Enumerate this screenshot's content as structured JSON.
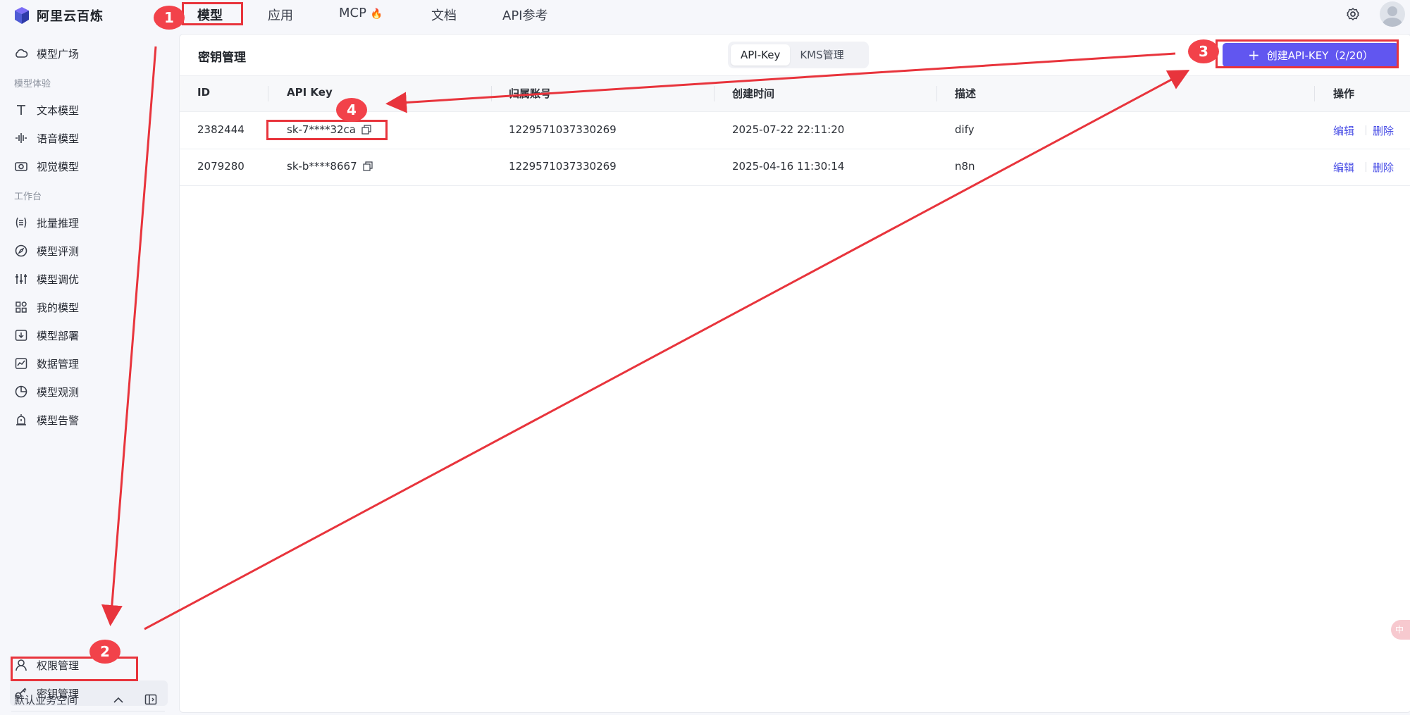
{
  "app": {
    "name": "阿里云百炼"
  },
  "topnav": {
    "items": [
      {
        "label": "模型"
      },
      {
        "label": "应用"
      },
      {
        "label": "MCP"
      },
      {
        "label": "文档"
      },
      {
        "label": "API参考"
      }
    ],
    "mcp_emoji": "🔥"
  },
  "sidebar": {
    "top_item": "模型广场",
    "group1": "模型体验",
    "group1_items": [
      "文本模型",
      "语音模型",
      "视觉模型"
    ],
    "group2": "工作台",
    "group2_items": [
      "批量推理",
      "模型评测",
      "模型调优",
      "我的模型",
      "模型部署",
      "数据管理",
      "模型观测",
      "模型告警"
    ],
    "bottom_items": [
      "权限管理",
      "密钥管理"
    ],
    "workspace": "默认业务空间"
  },
  "main": {
    "title": "密钥管理",
    "tabs": [
      "API-Key",
      "KMS管理"
    ],
    "create_button": "创建API-KEY（2/20）",
    "columns": [
      "ID",
      "API Key",
      "归属账号",
      "创建时间",
      "描述",
      "操作"
    ],
    "rows": [
      {
        "id": "2382444",
        "key": "sk-7****32ca",
        "account": "1229571037330269",
        "created": "2025-07-22 22:11:20",
        "desc": "dify",
        "edit": "编辑",
        "delete": "删除"
      },
      {
        "id": "2079280",
        "key": "sk-b****8667",
        "account": "1229571037330269",
        "created": "2025-04-16 11:30:14",
        "desc": "n8n",
        "edit": "编辑",
        "delete": "删除"
      }
    ]
  },
  "annotations": {
    "badges": [
      "1",
      "2",
      "3",
      "4"
    ],
    "color": "#e8343c"
  },
  "floating_tab": "中",
  "colors": {
    "accent": "#6156f0",
    "link": "#4b50e6",
    "annotation": "#e8343c"
  }
}
